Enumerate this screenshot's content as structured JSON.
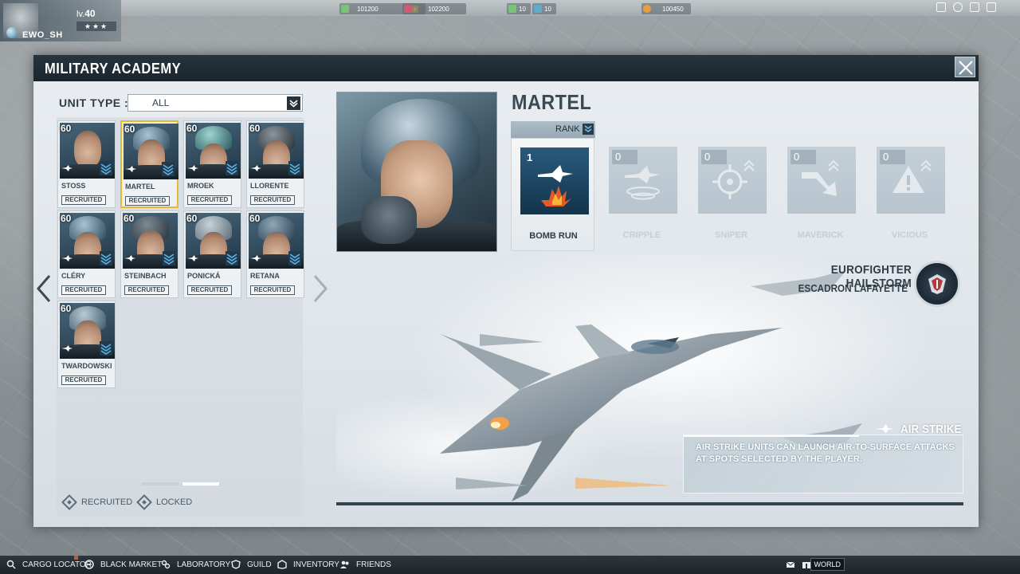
{
  "top_bar": {
    "resources": [
      {
        "value": "101200",
        "color": "#79c37a"
      },
      {
        "value": "102200",
        "color": "#d05a73"
      },
      {
        "value": "10",
        "color": "#79c37a"
      },
      {
        "value": "10",
        "color": "#65a9c9"
      },
      {
        "value": "100450",
        "color": "#e3a13e"
      }
    ],
    "window_icons": [
      "edit-icon",
      "eye-icon",
      "fullscreen-icon",
      "collapse-icon"
    ]
  },
  "player": {
    "level_prefix": "lv.",
    "level": "40",
    "stars": "★★★",
    "name": "EWO_SH"
  },
  "dialog": {
    "title": "MILITARY ACADEMY"
  },
  "filter": {
    "label": "UNIT TYPE :",
    "value": "ALL"
  },
  "units": [
    {
      "name": "STOSS",
      "level": "60",
      "status": "RECRUITED"
    },
    {
      "name": "MARTEL",
      "level": "60",
      "status": "RECRUITED",
      "selected": true
    },
    {
      "name": "MROEK",
      "level": "60",
      "status": "RECRUITED"
    },
    {
      "name": "LLORENTE",
      "level": "60",
      "status": "RECRUITED"
    },
    {
      "name": "CLÉRY",
      "level": "60",
      "status": "RECRUITED"
    },
    {
      "name": "STEINBACH",
      "level": "60",
      "status": "RECRUITED"
    },
    {
      "name": "PONICKÁ",
      "level": "60",
      "status": "RECRUITED"
    },
    {
      "name": "RETANA",
      "level": "60",
      "status": "RECRUITED"
    },
    {
      "name": "TWARDOWSKI",
      "level": "60",
      "status": "RECRUITED"
    }
  ],
  "legend": {
    "recruited": "RECRUITED",
    "locked": "LOCKED"
  },
  "detail": {
    "unit_name": "MARTEL",
    "rank_label": "RANK",
    "skills": [
      {
        "name": "BOMB RUN",
        "level": "1",
        "active": true,
        "icon": "bomb-run-icon"
      },
      {
        "name": "CRIPPLE",
        "level": "0",
        "active": false,
        "icon": "cripple-icon"
      },
      {
        "name": "SNIPER",
        "level": "0",
        "active": false,
        "icon": "sniper-icon"
      },
      {
        "name": "MAVERICK",
        "level": "0",
        "active": false,
        "icon": "maverick-icon"
      },
      {
        "name": "VICIOUS",
        "level": "0",
        "active": false,
        "icon": "vicious-icon"
      }
    ],
    "aircraft": "EUROFIGHTER HAILSTORM",
    "squadron": "ESCADRON LAFAYETTE",
    "role_title": "AIR STRIKE",
    "role_description": "AIR STRIKE UNITS CAN LAUNCH AIR-TO-SURFACE ATTACKS AT SPOTS SELECTED BY THE PLAYER."
  },
  "bottom_bar": {
    "items": [
      {
        "label": "CARGO LOCATOR",
        "icon": "cargo-locator-icon"
      },
      {
        "label": "BLACK MARKET",
        "icon": "black-market-icon"
      },
      {
        "label": "LABORATORY",
        "icon": "laboratory-icon"
      },
      {
        "label": "GUILD",
        "icon": "guild-icon"
      },
      {
        "label": "INVENTORY",
        "icon": "inventory-icon"
      },
      {
        "label": "FRIENDS",
        "icon": "friends-icon"
      }
    ],
    "world_label": "WORLD"
  }
}
